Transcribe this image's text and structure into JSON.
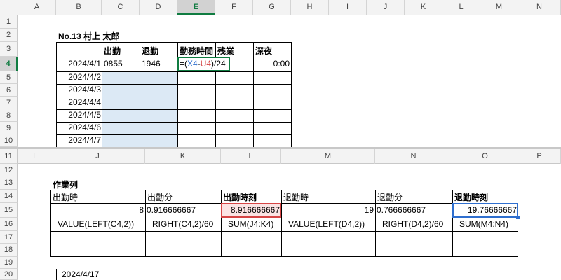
{
  "top_pane": {
    "columns": [
      "A",
      "B",
      "C",
      "D",
      "E",
      "F",
      "G",
      "H",
      "I",
      "J",
      "K",
      "L",
      "M",
      "N"
    ],
    "rows": [
      "1",
      "2",
      "3",
      "4",
      "5",
      "6",
      "7",
      "8",
      "9",
      "10"
    ],
    "title": "No.13 村上 太郎",
    "headers": [
      "出勤",
      "退勤",
      "勤務時間",
      "残業",
      "深夜"
    ],
    "dates": [
      "2024/4/1",
      "2024/4/2",
      "2024/4/3",
      "2024/4/4",
      "2024/4/5",
      "2024/4/6",
      "2024/4/7"
    ],
    "row4": {
      "in": "0855",
      "out": "1946",
      "formula_prefix": "=(",
      "formula_x": "X4",
      "formula_minus": "-",
      "formula_u": "U4",
      "formula_suffix": ")/24",
      "night": "0:00"
    }
  },
  "bottom_pane": {
    "columns": [
      "I",
      "J",
      "K",
      "L",
      "M",
      "N",
      "O",
      "P"
    ],
    "rows": [
      "11",
      "12",
      "13",
      "14",
      "15",
      "16",
      "17",
      "18",
      "19",
      "20"
    ],
    "section_title": "作業列",
    "headers": [
      "出勤時",
      "出勤分",
      "出勤時刻",
      "退勤時",
      "退勤分",
      "退勤時刻"
    ],
    "values": [
      "8",
      "0.916666667",
      "8.916666667",
      "19",
      "0.766666667",
      "19.76666667"
    ],
    "formulas": [
      "=VALUE(LEFT(C4,2))",
      "=RIGHT(C4,2)/60",
      "=SUM(J4:K4)",
      "=VALUE(LEFT(D4,2))",
      "=RIGHT(D4,2)/60",
      "=SUM(M4:N4)"
    ],
    "partial_date": "2024/4/17"
  },
  "colors": {
    "selection_green": "#107c41",
    "highlight_blue": "#dce9f5",
    "highlight_pink": "#fbe3e3",
    "selection_blue": "#2f6fcf",
    "error_red": "#d64545"
  }
}
